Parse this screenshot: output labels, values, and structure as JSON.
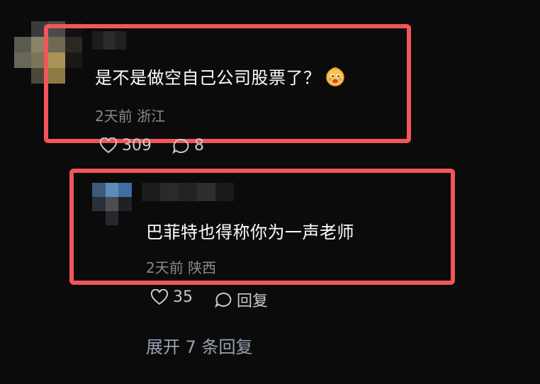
{
  "comments": [
    {
      "text": "是不是做空自己公司股票了？",
      "emoji_icon": "grinning-face-emoji",
      "date": "2天前",
      "location": "浙江",
      "likes": "309",
      "replies": "8"
    },
    {
      "text": "巴菲特也得称你为一声老师",
      "date": "2天前",
      "location": "陕西",
      "likes": "35",
      "reply_label": "回复"
    }
  ],
  "expand_label": "展开 7 条回复",
  "colors": {
    "highlight": "#f2555a",
    "background": "#0b0b0b",
    "meta_text": "#8a8a8a"
  }
}
